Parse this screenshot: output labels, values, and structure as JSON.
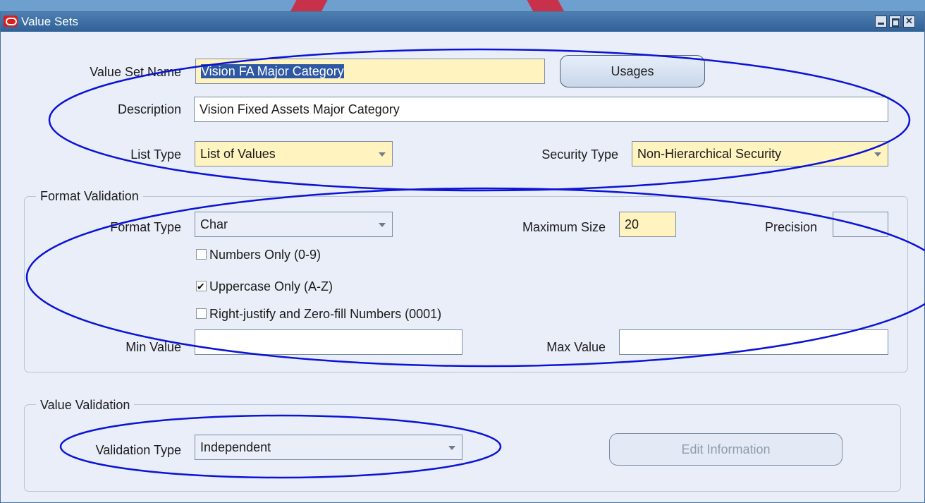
{
  "window": {
    "title": "Value Sets"
  },
  "header": {
    "value_set_name_label": "Value Set Name",
    "value_set_name_value": "Vision FA Major Category",
    "usages_button": "Usages",
    "description_label": "Description",
    "description_value": "Vision Fixed Assets Major Category",
    "list_type_label": "List Type",
    "list_type_value": "List of Values",
    "security_type_label": "Security Type",
    "security_type_value": "Non-Hierarchical Security"
  },
  "format_validation": {
    "title": "Format Validation",
    "format_type_label": "Format Type",
    "format_type_value": "Char",
    "maximum_size_label": "Maximum Size",
    "maximum_size_value": "20",
    "precision_label": "Precision",
    "precision_value": "",
    "numbers_only_label": "Numbers Only (0-9)",
    "numbers_only_checked": false,
    "uppercase_only_label": "Uppercase Only (A-Z)",
    "uppercase_only_checked": true,
    "right_justify_label": "Right-justify and Zero-fill Numbers (0001)",
    "right_justify_checked": false,
    "min_value_label": "Min Value",
    "min_value_value": "",
    "max_value_label": "Max Value",
    "max_value_value": ""
  },
  "value_validation": {
    "title": "Value Validation",
    "validation_type_label": "Validation Type",
    "validation_type_value": "Independent",
    "edit_information_button": "Edit Information"
  },
  "colors": {
    "annotation_stroke": "#0a13d6",
    "required_field": "#fff3c0",
    "title_bar": "#3a6da3",
    "form_background": "#e9eef8"
  }
}
